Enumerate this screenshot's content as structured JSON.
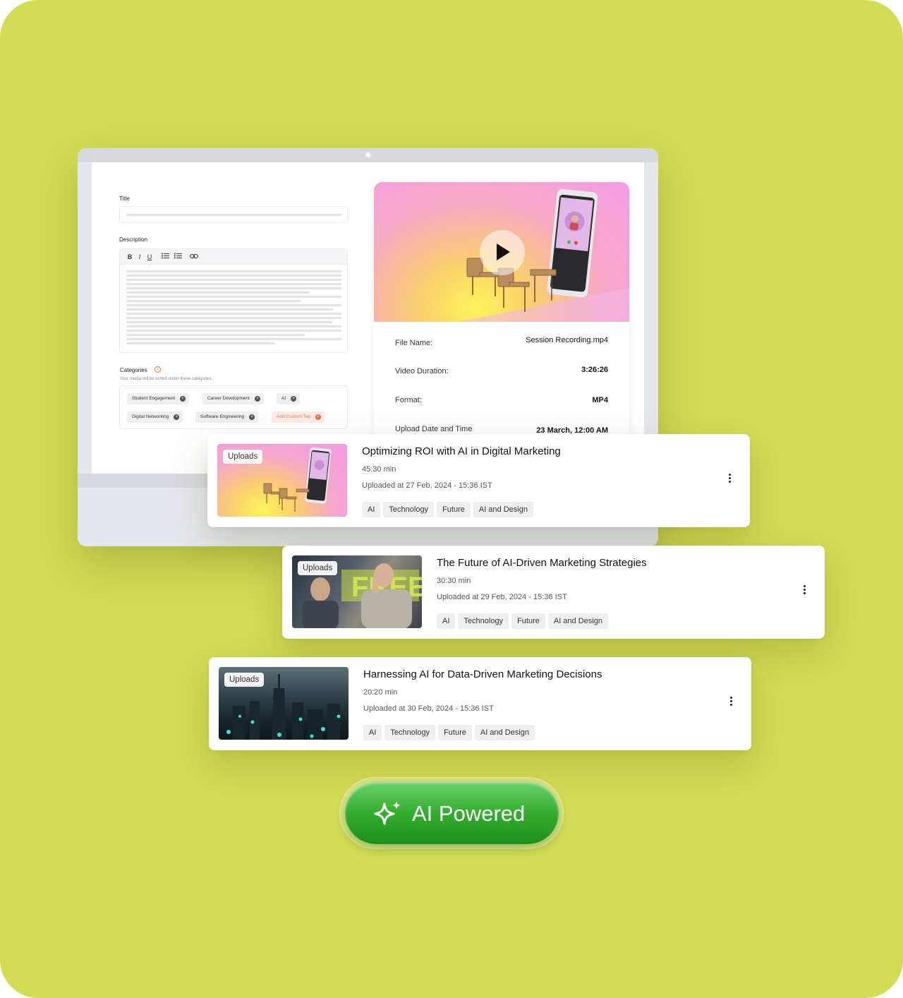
{
  "editor_form": {
    "title_label": "Title",
    "description_label": "Description",
    "toolbar": [
      "B",
      "I",
      "U"
    ],
    "categories_label": "Categories",
    "categories_hint": "Your media will be sorted under these categories.",
    "categories": [
      "Student Engagement",
      "Career Development",
      "AI",
      "Digital Networking",
      "Software Engineering"
    ],
    "add_custom_tag": "Add Custom Tag"
  },
  "video_details": {
    "file_name_label": "File Name:",
    "file_name": "Session Recording.mp4",
    "duration_label": "Video Duration:",
    "duration": "3:26:26",
    "format_label": "Format:",
    "format": "MP4",
    "upload_label": "Upload Date and Time",
    "upload_value": "23 March, 12:00 AM"
  },
  "uploads": [
    {
      "badge": "Uploads",
      "title": "Optimizing ROI with AI in Digital Marketing",
      "duration": "45:30 min",
      "uploaded": "Uploaded at 27 Feb, 2024 - 15:36 IST",
      "tags": [
        "AI",
        "Technology",
        "Future",
        "AI and Design"
      ]
    },
    {
      "badge": "Uploads",
      "title": "The Future of AI-Driven Marketing Strategies",
      "duration": "30:30 min",
      "uploaded": "Uploaded at 29 Feb, 2024 - 15:36 IST",
      "tags": [
        "AI",
        "Technology",
        "Future",
        "AI and Design"
      ]
    },
    {
      "badge": "Uploads",
      "title": "Harnessing AI for Data-Driven Marketing Decisions",
      "duration": "20:20 min",
      "uploaded": "Uploaded at 30 Feb, 2024 - 15:36 IST",
      "tags": [
        "AI",
        "Technology",
        "Future",
        "AI and Design"
      ]
    }
  ],
  "cta": {
    "label": "AI Powered",
    "icon": "sparkle-icon"
  },
  "colors": {
    "background": "#d3dc55",
    "cta_green": "#34ad2f",
    "accent_orange": "#e8743a"
  }
}
